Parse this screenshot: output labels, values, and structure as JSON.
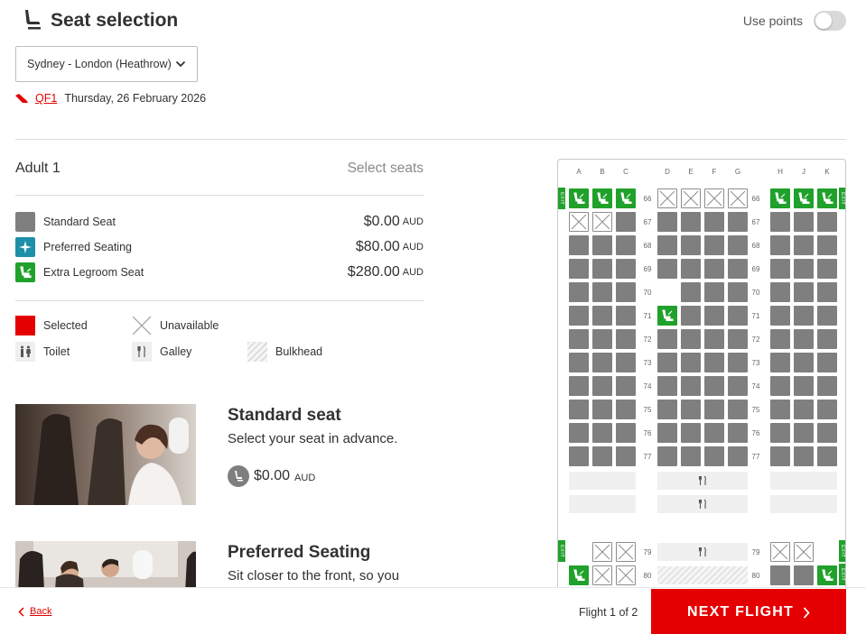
{
  "header": {
    "title": "Seat selection",
    "use_points_label": "Use points",
    "use_points_on": false
  },
  "route": {
    "selected": "Sydney - London (Heathrow)"
  },
  "flight": {
    "number": "QF1",
    "date": "Thursday, 26 February 2026"
  },
  "passenger": {
    "name": "Adult 1",
    "action": "Select seats"
  },
  "seat_types": [
    {
      "label": "Standard Seat",
      "amount": "$0.00",
      "currency": "AUD",
      "color": "#7f7f7f",
      "icon": ""
    },
    {
      "label": "Preferred Seating",
      "amount": "$80.00",
      "currency": "AUD",
      "color": "#1e8fa8",
      "icon": "sparkle-icon"
    },
    {
      "label": "Extra Legroom Seat",
      "amount": "$280.00",
      "currency": "AUD",
      "color": "#20a12b",
      "icon": "legroom-seat-icon"
    }
  ],
  "legend": {
    "selected": "Selected",
    "unavailable": "Unavailable",
    "toilet": "Toilet",
    "galley": "Galley",
    "bulkhead": "Bulkhead",
    "selected_color": "#e40000"
  },
  "cards": [
    {
      "title": "Standard seat",
      "desc": "Select your seat in advance.",
      "amount": "$0.00",
      "currency": "AUD"
    },
    {
      "title": "Preferred Seating",
      "desc": "Sit closer to the front, so you"
    }
  ],
  "seatmap": {
    "columns": [
      "A",
      "B",
      "C",
      "D",
      "E",
      "F",
      "G",
      "H",
      "J",
      "K"
    ],
    "rows": [
      "66",
      "67",
      "68",
      "69",
      "70",
      "71",
      "72",
      "73",
      "74",
      "75",
      "76",
      "77"
    ],
    "rear_rows": [
      "79",
      "80"
    ],
    "exit_label": "EXIT"
  },
  "footer": {
    "back": "Back",
    "flight_count": "Flight 1 of 2",
    "next": "NEXT FLIGHT"
  }
}
